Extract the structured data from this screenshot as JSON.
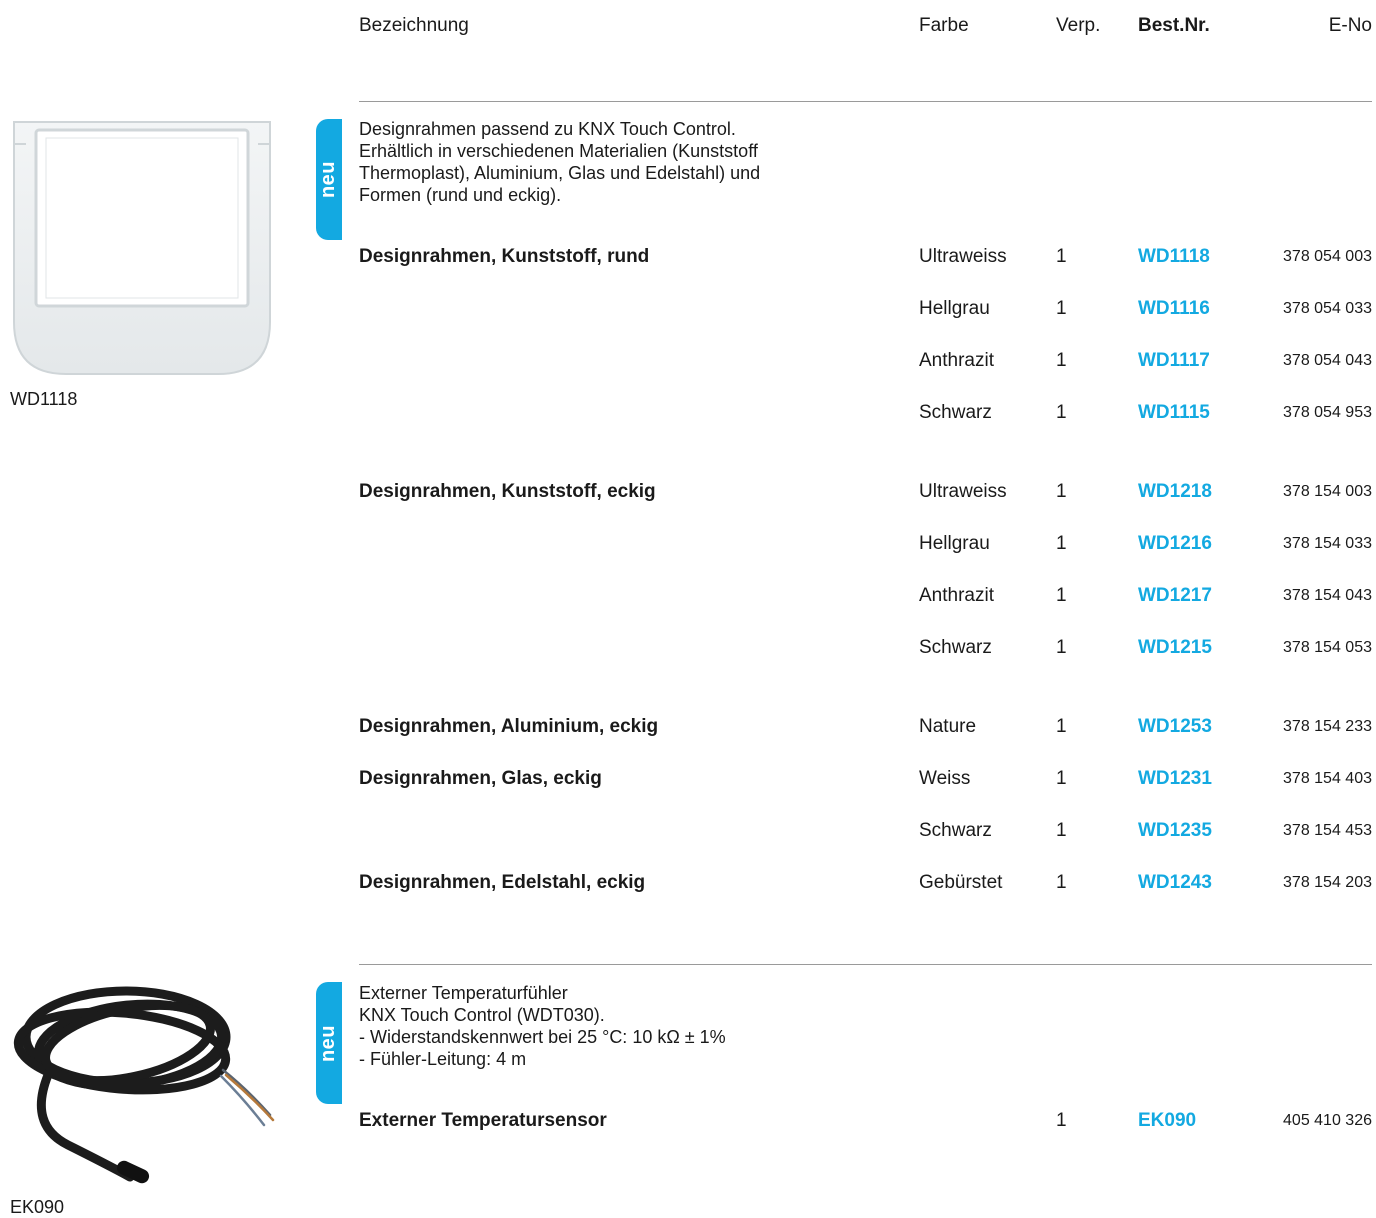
{
  "header": {
    "bezeichnung": "Bezeichnung",
    "farbe": "Farbe",
    "verp": "Verp.",
    "best_nr": "Best.Nr.",
    "e_no": "E-No"
  },
  "colors": {
    "accent": "#13a9e1",
    "rule": "#9a9a9a"
  },
  "sections": [
    {
      "badge": "neu",
      "image_caption": "WD1118",
      "image_icon": "design-frame-icon",
      "description": [
        "Designrahmen passend zu KNX Touch Control.",
        "Erhältlich in verschiedenen Materialien (Kunststoff",
        "Thermoplast), Aluminium, Glas und Edelstahl) und",
        "Formen (rund und eckig)."
      ],
      "rows": [
        {
          "name": "Designrahmen, Kunststoff, rund",
          "farbe": "Ultraweiss",
          "verp": "1",
          "best": "WD1118",
          "eno": "378 054 003"
        },
        {
          "name": "",
          "farbe": "Hellgrau",
          "verp": "1",
          "best": "WD1116",
          "eno": "378 054 033"
        },
        {
          "name": "",
          "farbe": "Anthrazit",
          "verp": "1",
          "best": "WD1117",
          "eno": "378 054 043"
        },
        {
          "name": "",
          "farbe": "Schwarz",
          "verp": "1",
          "best": "WD1115",
          "eno": "378 054 953"
        },
        {
          "name": "Designrahmen, Kunststoff, eckig",
          "farbe": "Ultraweiss",
          "verp": "1",
          "best": "WD1218",
          "eno": "378 154 003"
        },
        {
          "name": "",
          "farbe": "Hellgrau",
          "verp": "1",
          "best": "WD1216",
          "eno": "378 154 033"
        },
        {
          "name": "",
          "farbe": "Anthrazit",
          "verp": "1",
          "best": "WD1217",
          "eno": "378 154 043"
        },
        {
          "name": "",
          "farbe": "Schwarz",
          "verp": "1",
          "best": "WD1215",
          "eno": "378 154 053"
        },
        {
          "name": "Designrahmen, Aluminium, eckig",
          "farbe": "Nature",
          "verp": "1",
          "best": "WD1253",
          "eno": "378 154 233"
        },
        {
          "name": "Designrahmen, Glas, eckig",
          "farbe": "Weiss",
          "verp": "1",
          "best": "WD1231",
          "eno": "378 154 403"
        },
        {
          "name": "",
          "farbe": "Schwarz",
          "verp": "1",
          "best": "WD1235",
          "eno": "378 154 453"
        },
        {
          "name": "Designrahmen, Edelstahl, eckig",
          "farbe": "Gebürstet",
          "verp": "1",
          "best": "WD1243",
          "eno": "378 154 203"
        }
      ]
    },
    {
      "badge": "neu",
      "image_caption": "EK090",
      "image_icon": "temperature-sensor-cable-icon",
      "description": [
        "Externer Temperaturfühler",
        "KNX Touch Control (WDT030).",
        "- Widerstandskennwert bei 25 °C: 10 kΩ ± 1%",
        "- Fühler-Leitung: 4 m"
      ],
      "rows": [
        {
          "name": "Externer Temperatursensor",
          "farbe": "",
          "verp": "1",
          "best": "EK090",
          "eno": "405 410 326"
        }
      ]
    }
  ]
}
